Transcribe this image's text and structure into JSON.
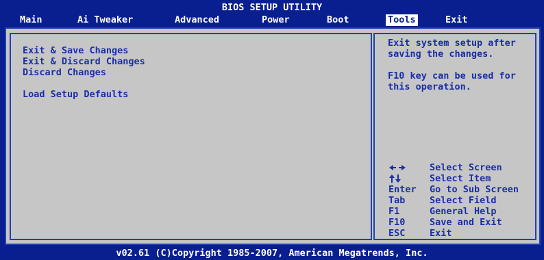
{
  "title": "BIOS SETUP UTILITY",
  "tabs": [
    {
      "label": "Main"
    },
    {
      "label": "Ai Tweaker"
    },
    {
      "label": "Advanced"
    },
    {
      "label": "Power"
    },
    {
      "label": "Boot"
    },
    {
      "label": "Tools"
    },
    {
      "label": "Exit"
    }
  ],
  "active_tab": "Tools",
  "menu_items": [
    {
      "label": "Exit & Save Changes"
    },
    {
      "label": "Exit & Discard Changes"
    },
    {
      "label": "Discard Changes"
    },
    {
      "label": "Load Setup Defaults"
    }
  ],
  "help": {
    "line1": "Exit system setup after",
    "line2": "saving the changes.",
    "line3": "F10 key can be used for",
    "line4": "this operation."
  },
  "key_help": [
    {
      "key_icon": "left-right-arrows-icon",
      "key": "",
      "desc": "Select Screen"
    },
    {
      "key_icon": "up-down-arrows-icon",
      "key": "",
      "desc": "Select Item"
    },
    {
      "key": "Enter",
      "desc": "Go to Sub Screen"
    },
    {
      "key": "Tab",
      "desc": "Select Field"
    },
    {
      "key": "F1",
      "desc": "General Help"
    },
    {
      "key": "F10",
      "desc": "Save and Exit"
    },
    {
      "key": "ESC",
      "desc": "Exit"
    }
  ],
  "footer": "v02.61 (C)Copyright 1985-2007, American Megatrends, Inc.",
  "colors": {
    "background": "#0a1f8f",
    "panel": "#c6c6c6",
    "text_blue": "#1a2ea8",
    "text_white": "#ffffff"
  }
}
